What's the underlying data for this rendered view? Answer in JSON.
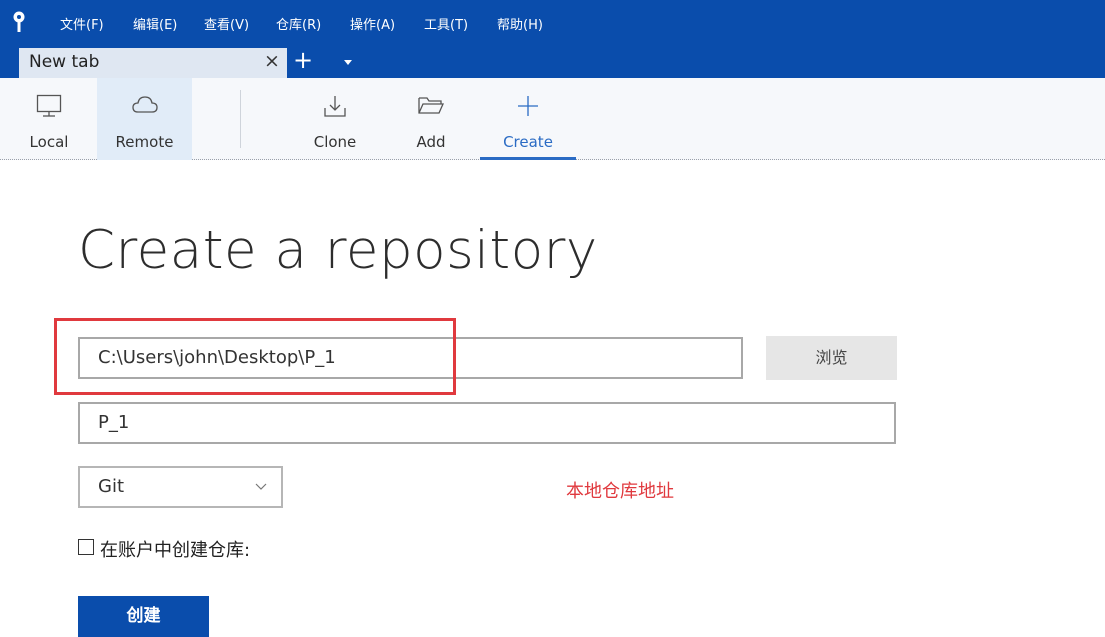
{
  "menu": {
    "items": [
      "文件(F)",
      "编辑(E)",
      "查看(V)",
      "仓库(R)",
      "操作(A)",
      "工具(T)",
      "帮助(H)"
    ]
  },
  "tabs": {
    "current": "New tab",
    "close_glyph": "×",
    "add_glyph": "+"
  },
  "toolbar": {
    "local": "Local",
    "remote": "Remote",
    "clone": "Clone",
    "add": "Add",
    "create": "Create",
    "active_item": "Remote",
    "selected_item": "Create"
  },
  "main": {
    "title": "Create a repository",
    "path_value": "C:\\Users\\john\\Desktop\\P_1",
    "name_value": "P_1",
    "browse_label": "浏览",
    "vcs_type": "Git",
    "annotation": "本地仓库地址",
    "account_checkbox_label": "在账户中创建仓库:",
    "account_checkbox_checked": false,
    "create_button": "创建"
  },
  "colors": {
    "header": "#0a4dac",
    "accent": "#2a6bc4",
    "highlight": "#e0393e"
  }
}
